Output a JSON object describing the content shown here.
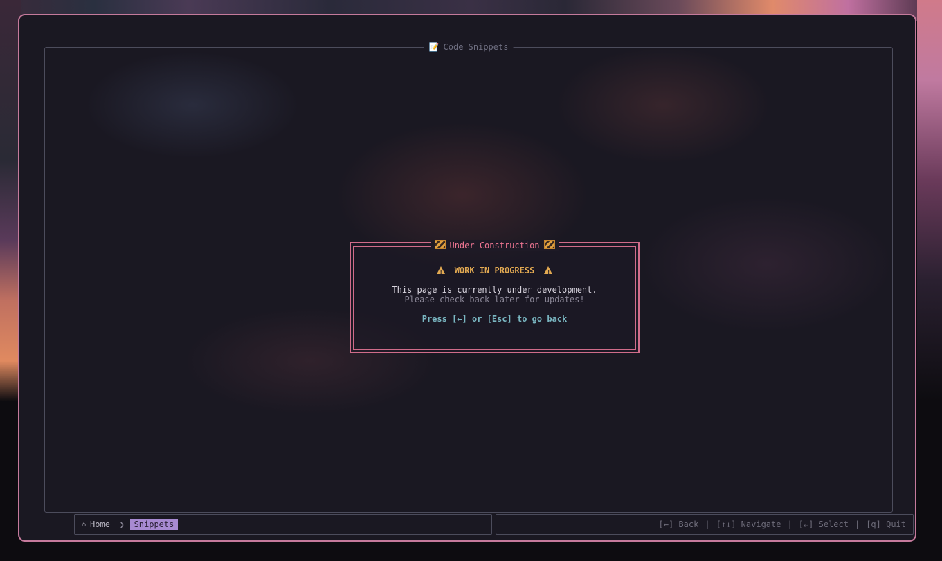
{
  "window": {
    "title": "Code Snippets",
    "title_icon": "memo-icon"
  },
  "dialog": {
    "title": "Under Construction",
    "title_icon": "construction-sign-icon",
    "heading": "WORK IN PROGRESS",
    "heading_icon": "warning-icon",
    "message": "This page is currently under development.",
    "submessage": "Please check back later for updates!",
    "hint": "Press [←] or [Esc] to go back"
  },
  "breadcrumb": {
    "home_icon": "home-icon",
    "home": "Home",
    "separator": "❯",
    "current": "Snippets"
  },
  "keybindings": [
    {
      "label": "[←] Back"
    },
    {
      "label": "[↑↓] Navigate"
    },
    {
      "label": "[↵] Select"
    },
    {
      "label": "[q] Quit"
    }
  ],
  "colors": {
    "window_border": "#c57a9c",
    "dialog_border": "#d06c8a",
    "dialog_title": "#ee7592",
    "warning": "#e3aa52",
    "hint": "#7ab7c2",
    "breadcrumb_highlight": "#a88ad2"
  }
}
